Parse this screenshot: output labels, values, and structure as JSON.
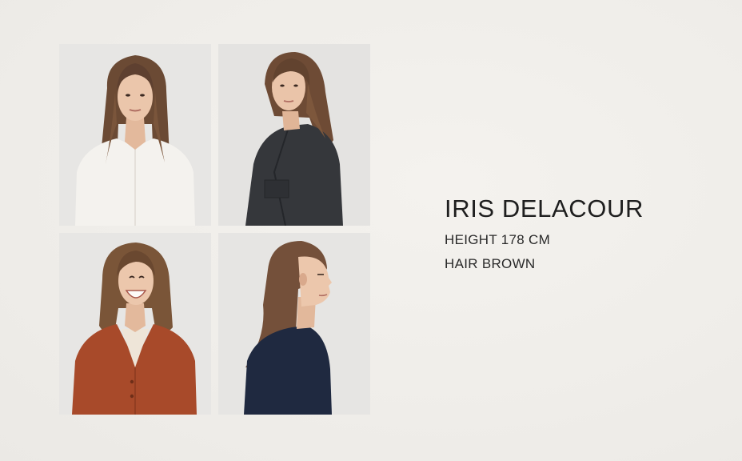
{
  "model": {
    "name": "IRIS DELACOUR",
    "height": "HEIGHT 178 CM",
    "hair": "HAIR BROWN"
  },
  "photos": [
    {
      "pose": "front",
      "outfit": "white blouse",
      "outfit_color": "#f3f1ec"
    },
    {
      "pose": "three-quarter",
      "outfit": "dark grey jacket",
      "outfit_color": "#35373b"
    },
    {
      "pose": "smiling",
      "outfit": "rust cardigan",
      "outfit_color": "#a84a2a"
    },
    {
      "pose": "profile",
      "outfit": "navy sweater",
      "outfit_color": "#1f2940"
    }
  ],
  "colors": {
    "background": "#f1efeb",
    "photo_background": "#e6e5e3",
    "hair": "#6b4a34",
    "skin": "#e8c3a8",
    "text": "#222222"
  }
}
